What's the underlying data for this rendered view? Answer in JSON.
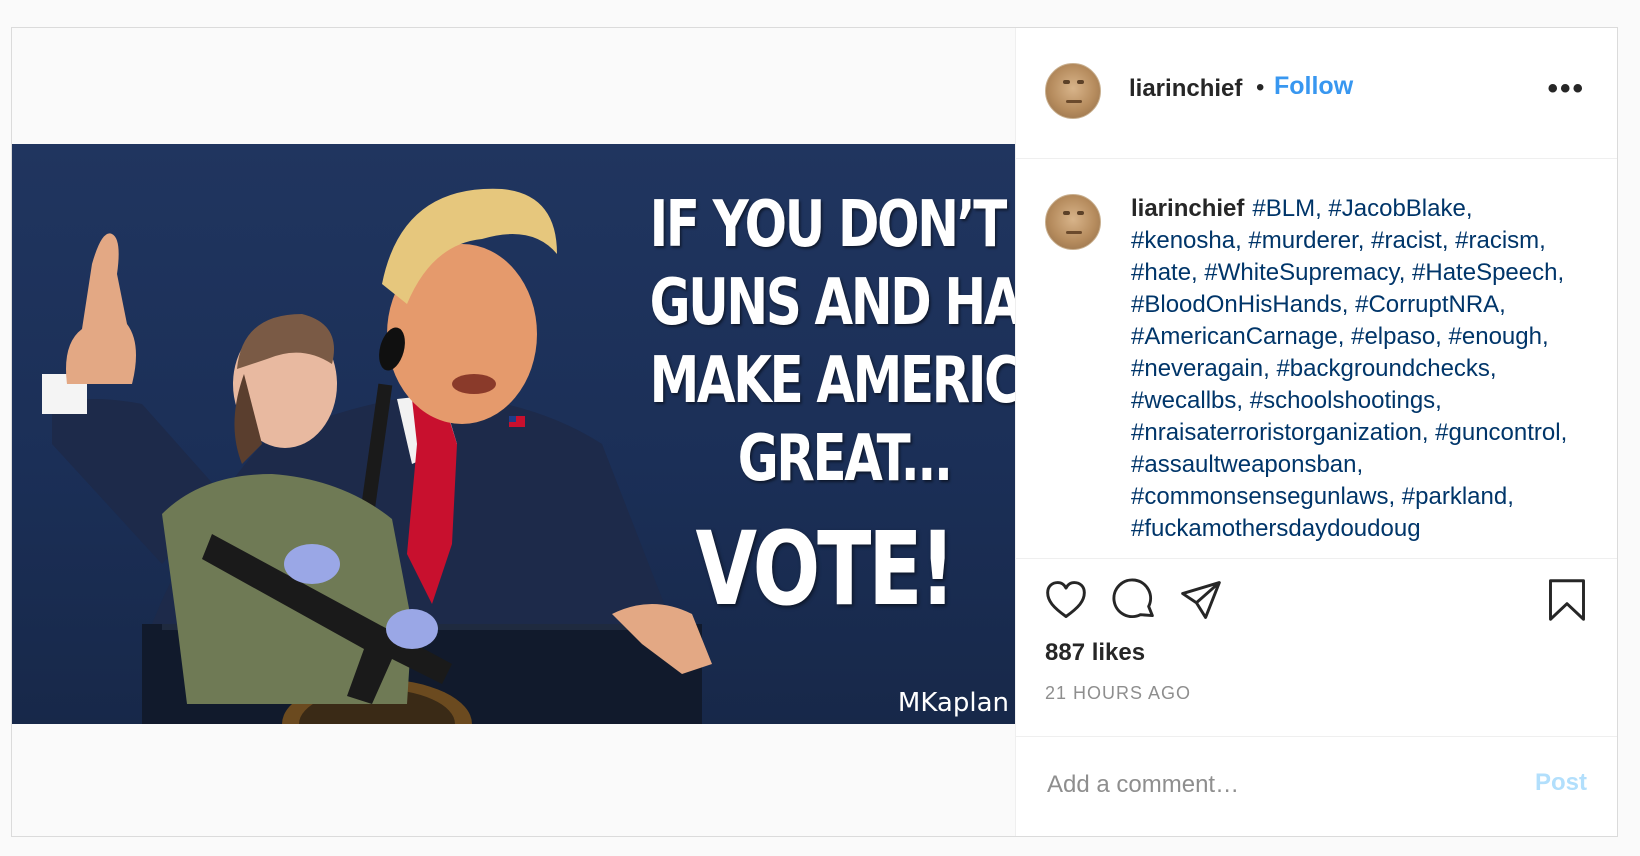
{
  "post": {
    "username": "liarinchief",
    "separator": "•",
    "follow_label": "Follow",
    "more_label": "•••"
  },
  "image": {
    "headline_lines": [
      "IF YOU DON’T THINK",
      "GUNS AND HATE",
      "MAKE AMERICA",
      "GREAT..."
    ],
    "vote_text": "VOTE!",
    "signature": "MKaplan"
  },
  "caption": {
    "username": "liarinchief",
    "text": "#BLM, #JacobBlake, #kenosha, #murderer, #racist, #racism, #hate, #WhiteSupremacy, #HateSpeech, #BloodOnHisHands, #CorruptNRA, #AmericanCarnage, #elpaso, #enough, #neveragain, #backgroundchecks, #wecallbs, #schoolshootings, #nraisaterroristorganization, #guncontrol, #assaultweaponsban, #commonsensegunlaws, #parkland, #fuckamothersdaydoudoug"
  },
  "stats": {
    "likes": "887 likes",
    "time": "21 HOURS AGO"
  },
  "comment_box": {
    "placeholder": "Add a comment…",
    "post_label": "Post"
  },
  "icons": [
    "heart-icon",
    "comment-icon",
    "share-icon",
    "bookmark-icon",
    "more-icon"
  ],
  "colors": {
    "link_blue": "#3897f0",
    "hashtag": "#003569",
    "post_disabled": "#b2dffc",
    "image_bg": "#1b2f57"
  }
}
